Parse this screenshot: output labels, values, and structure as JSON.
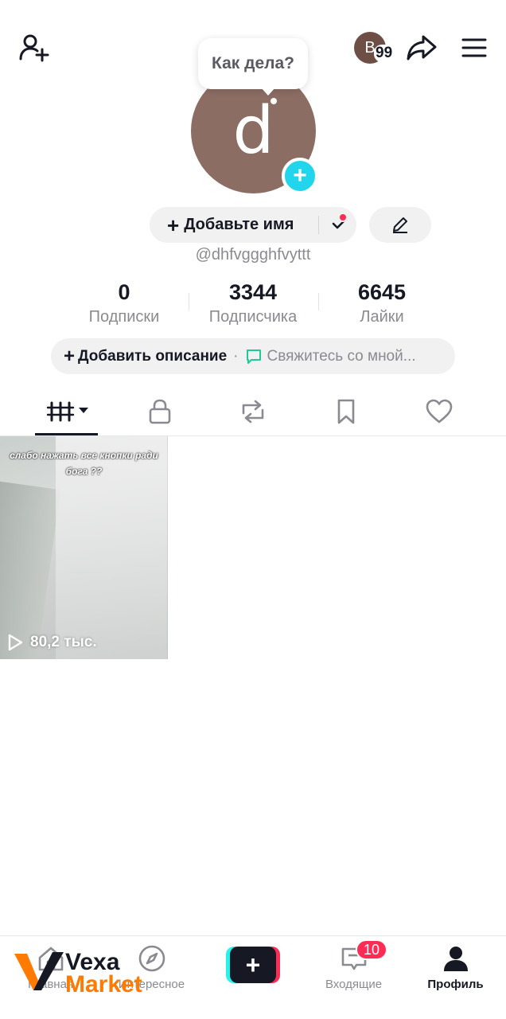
{
  "header": {
    "mini_avatar_letter": "B",
    "mini_avatar_count": "99"
  },
  "profile": {
    "avatar_letter": "d",
    "bubble_text": "Как дела?",
    "add_name_label": "Добавьте имя",
    "username": "@dhfvggghfvyttt"
  },
  "stats": [
    {
      "value": "0",
      "label": "Подписки"
    },
    {
      "value": "3344",
      "label": "Подписчика"
    },
    {
      "value": "6645",
      "label": "Лайки"
    }
  ],
  "bio": {
    "add_label": "Добавить описание",
    "separator": "·",
    "contact_label": "Свяжитесь со мной..."
  },
  "tabs": [
    {
      "icon": "grid-icon",
      "active": true
    },
    {
      "icon": "lock-icon",
      "active": false
    },
    {
      "icon": "repost-icon",
      "active": false
    },
    {
      "icon": "bookmark-icon",
      "active": false
    },
    {
      "icon": "heart-icon",
      "active": false
    }
  ],
  "videos": [
    {
      "caption": "слабо нажать все кнопки ради бога ??",
      "views": "80,2 тыс."
    }
  ],
  "bottom_nav": {
    "home_label": "Главная",
    "explore_label": "Интересное",
    "inbox_label": "Входящие",
    "inbox_badge": "10",
    "profile_label": "Профиль"
  },
  "watermark": {
    "line1": "Vexa",
    "line2": "Market"
  },
  "colors": {
    "accent_red": "#fe2c55",
    "accent_cyan": "#25f4ee",
    "avatar_plus": "#20d5ec",
    "watermark_orange": "#ff7a00"
  }
}
